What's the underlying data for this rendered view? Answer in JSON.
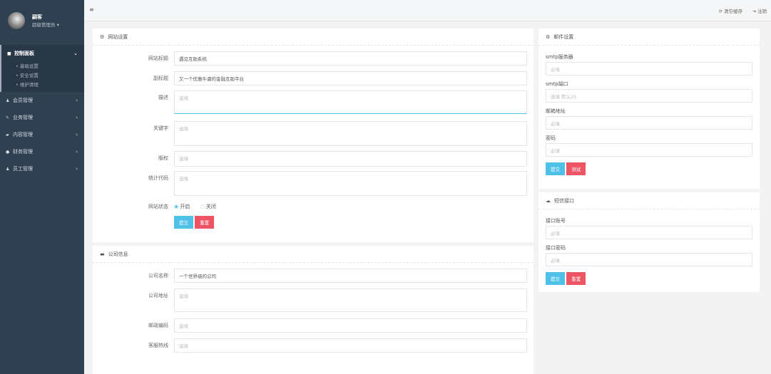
{
  "user": {
    "name": "嗣客",
    "role": "超级管理员 ▾"
  },
  "nav": [
    {
      "label": "控制面板",
      "icon": "home-icon",
      "expanded": true,
      "subs": [
        "基础设置",
        "安全设置",
        "维护清理"
      ]
    },
    {
      "label": "会员管理"
    },
    {
      "label": "业务管理"
    },
    {
      "label": "内容管理"
    },
    {
      "label": "财务管理"
    },
    {
      "label": "员工管理"
    }
  ],
  "topbar": {
    "clear_cache": "清空缓存",
    "logout": "注销"
  },
  "site": {
    "title": "网站设置",
    "fields": [
      {
        "label": "网站标题",
        "value": "遇见互助系统",
        "placeholder": ""
      },
      {
        "label": "副标题",
        "value": "又一个优雅牛逼的金融互助平台",
        "placeholder": ""
      },
      {
        "label": "描述",
        "value": "",
        "placeholder": "选填"
      },
      {
        "label": "关键字",
        "value": "",
        "placeholder": "选填"
      },
      {
        "label": "版权",
        "value": "",
        "placeholder": "选填"
      },
      {
        "label": "统计代码",
        "value": "",
        "placeholder": "选填"
      }
    ],
    "status_label": "网站状态",
    "status_on": "开启",
    "status_off": "关闭",
    "submit": "提交",
    "reset": "重置"
  },
  "company": {
    "title": "公司信息",
    "fields": [
      {
        "label": "公司名称",
        "value": "一个世界级的公司",
        "placeholder": ""
      },
      {
        "label": "公司地址",
        "value": "",
        "placeholder": "选填"
      },
      {
        "label": "邮政编码",
        "value": "",
        "placeholder": "选填"
      },
      {
        "label": "客服热线",
        "value": "",
        "placeholder": "选填"
      }
    ]
  },
  "mail": {
    "title": "邮件设置",
    "fields": [
      {
        "label": "smtp服务器",
        "placeholder": "必填"
      },
      {
        "label": "smtp端口",
        "placeholder": "选填 默认25"
      },
      {
        "label": "邮箱地址",
        "placeholder": "必填"
      },
      {
        "label": "密码",
        "placeholder": "必填"
      }
    ],
    "submit": "提交",
    "test": "测试"
  },
  "sms": {
    "title": "短信接口",
    "fields": [
      {
        "label": "接口账号",
        "placeholder": "必填"
      },
      {
        "label": "接口密码",
        "placeholder": "必填"
      }
    ],
    "submit": "提交",
    "reset": "重置"
  }
}
